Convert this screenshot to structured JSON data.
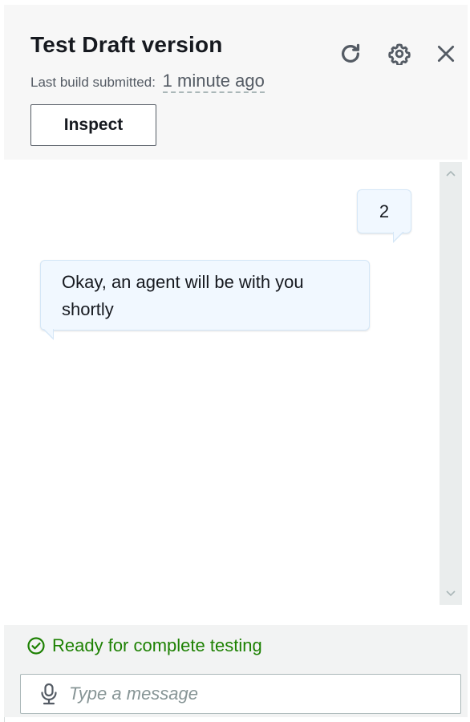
{
  "header": {
    "title": "Test Draft version",
    "subtitle_label": "Last build submitted:",
    "subtitle_time": "1 minute ago",
    "inspect_label": "Inspect",
    "icons": [
      "refresh-icon",
      "settings-icon",
      "close-icon"
    ]
  },
  "conversation": {
    "messages": [
      {
        "sender": "user",
        "text": "2"
      },
      {
        "sender": "bot",
        "text": "Okay, an agent will be with you shortly"
      }
    ]
  },
  "footer": {
    "status_text": "Ready for complete testing",
    "status_color": "#1d8102",
    "input_placeholder": "Type a message",
    "input_value": ""
  },
  "colors": {
    "header_bg": "#f7f7f7",
    "bubble_bg": "#f1f8ff",
    "footer_bg": "#f2f3f3"
  }
}
